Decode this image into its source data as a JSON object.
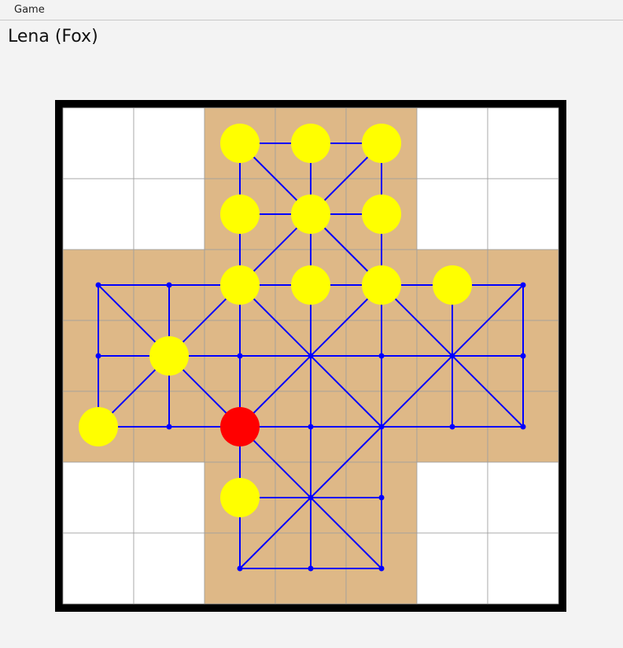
{
  "menu": {
    "items": [
      "Game"
    ]
  },
  "status": {
    "current_player": "Lena (Fox)"
  },
  "board": {
    "grid_size": 7,
    "colors": {
      "frame": "#000000",
      "empty_cell": "#ffffff",
      "play_cell": "#deb887",
      "grid_line": "#9e9e9e",
      "edge": "#0000ff",
      "goose": "#ffff00",
      "fox": "#ff0000"
    },
    "points": [
      [
        2,
        0
      ],
      [
        3,
        0
      ],
      [
        4,
        0
      ],
      [
        2,
        1
      ],
      [
        3,
        1
      ],
      [
        4,
        1
      ],
      [
        0,
        2
      ],
      [
        1,
        2
      ],
      [
        2,
        2
      ],
      [
        3,
        2
      ],
      [
        4,
        2
      ],
      [
        5,
        2
      ],
      [
        6,
        2
      ],
      [
        0,
        3
      ],
      [
        1,
        3
      ],
      [
        2,
        3
      ],
      [
        3,
        3
      ],
      [
        4,
        3
      ],
      [
        5,
        3
      ],
      [
        6,
        3
      ],
      [
        0,
        4
      ],
      [
        1,
        4
      ],
      [
        2,
        4
      ],
      [
        3,
        4
      ],
      [
        4,
        4
      ],
      [
        5,
        4
      ],
      [
        6,
        4
      ],
      [
        2,
        5
      ],
      [
        3,
        5
      ],
      [
        4,
        5
      ],
      [
        2,
        6
      ],
      [
        3,
        6
      ],
      [
        4,
        6
      ]
    ],
    "edges": [
      [
        [
          2,
          0
        ],
        [
          4,
          0
        ]
      ],
      [
        [
          2,
          1
        ],
        [
          4,
          1
        ]
      ],
      [
        [
          0,
          2
        ],
        [
          6,
          2
        ]
      ],
      [
        [
          0,
          3
        ],
        [
          6,
          3
        ]
      ],
      [
        [
          0,
          4
        ],
        [
          6,
          4
        ]
      ],
      [
        [
          2,
          5
        ],
        [
          4,
          5
        ]
      ],
      [
        [
          2,
          6
        ],
        [
          4,
          6
        ]
      ],
      [
        [
          0,
          2
        ],
        [
          0,
          4
        ]
      ],
      [
        [
          1,
          2
        ],
        [
          1,
          4
        ]
      ],
      [
        [
          2,
          0
        ],
        [
          2,
          6
        ]
      ],
      [
        [
          3,
          0
        ],
        [
          3,
          6
        ]
      ],
      [
        [
          4,
          0
        ],
        [
          4,
          6
        ]
      ],
      [
        [
          5,
          2
        ],
        [
          5,
          4
        ]
      ],
      [
        [
          6,
          2
        ],
        [
          6,
          4
        ]
      ],
      [
        [
          2,
          0
        ],
        [
          3,
          1
        ]
      ],
      [
        [
          3,
          1
        ],
        [
          4,
          2
        ]
      ],
      [
        [
          4,
          2
        ],
        [
          6,
          4
        ]
      ],
      [
        [
          0,
          2
        ],
        [
          2,
          4
        ]
      ],
      [
        [
          2,
          2
        ],
        [
          4,
          4
        ]
      ],
      [
        [
          4,
          4
        ],
        [
          2,
          6
        ]
      ],
      [
        [
          4,
          0
        ],
        [
          3,
          1
        ]
      ],
      [
        [
          3,
          1
        ],
        [
          2,
          2
        ]
      ],
      [
        [
          2,
          2
        ],
        [
          0,
          4
        ]
      ],
      [
        [
          4,
          2
        ],
        [
          2,
          4
        ]
      ],
      [
        [
          6,
          2
        ],
        [
          4,
          4
        ]
      ],
      [
        [
          2,
          4
        ],
        [
          4,
          6
        ]
      ]
    ],
    "geese": [
      [
        2,
        0
      ],
      [
        3,
        0
      ],
      [
        4,
        0
      ],
      [
        2,
        1
      ],
      [
        3,
        1
      ],
      [
        4,
        1
      ],
      [
        2,
        2
      ],
      [
        3,
        2
      ],
      [
        4,
        2
      ],
      [
        5,
        2
      ],
      [
        1,
        3
      ],
      [
        0,
        4
      ],
      [
        2,
        5
      ]
    ],
    "fox": [
      2,
      4
    ]
  }
}
